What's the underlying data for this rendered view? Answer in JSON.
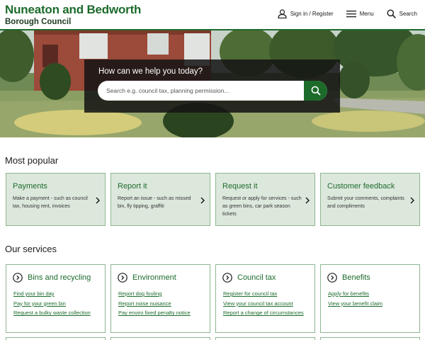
{
  "header": {
    "logo_line1": "Nuneaton and Bedworth",
    "logo_line2": "Borough Council",
    "nav": [
      {
        "label": "Sign in / Register",
        "icon": "user-icon"
      },
      {
        "label": "Menu",
        "icon": "menu-icon"
      },
      {
        "label": "Search",
        "icon": "search-icon"
      }
    ]
  },
  "hero": {
    "title": "How can we help you today?",
    "search_placeholder": "Search e.g. council tax, planning permission..."
  },
  "most_popular": {
    "heading": "Most popular",
    "cards": [
      {
        "title": "Payments",
        "description": "Make a payment - such as council tax, housing rent, invoices"
      },
      {
        "title": "Report it",
        "description": "Report an issue - such as missed bin, fly tipping, graffiti"
      },
      {
        "title": "Request it",
        "description": "Request or apply for services - such as green bins, car park season tickets"
      },
      {
        "title": "Customer feedback",
        "description": "Submit your comments, complaints and compliments"
      }
    ]
  },
  "services": {
    "heading": "Our services",
    "cards": [
      {
        "title": "Bins and recycling",
        "links": [
          "Find your bin day",
          "Pay for your green bin",
          "Request a bulky waste collection"
        ]
      },
      {
        "title": "Environment",
        "links": [
          "Report dog fouling",
          "Report noise nuisance",
          "Pay enviro fixed penalty notice"
        ]
      },
      {
        "title": "Council tax",
        "links": [
          "Register for council tax",
          "View your council tax account",
          "Report a change of circumstances"
        ]
      },
      {
        "title": "Benefits",
        "links": [
          "Apply for benefits",
          "View your benefit claim"
        ]
      }
    ]
  },
  "colors": {
    "brand_green": "#1c6b2b",
    "card_bg": "#dde8dd",
    "card_border": "#8db58f"
  }
}
